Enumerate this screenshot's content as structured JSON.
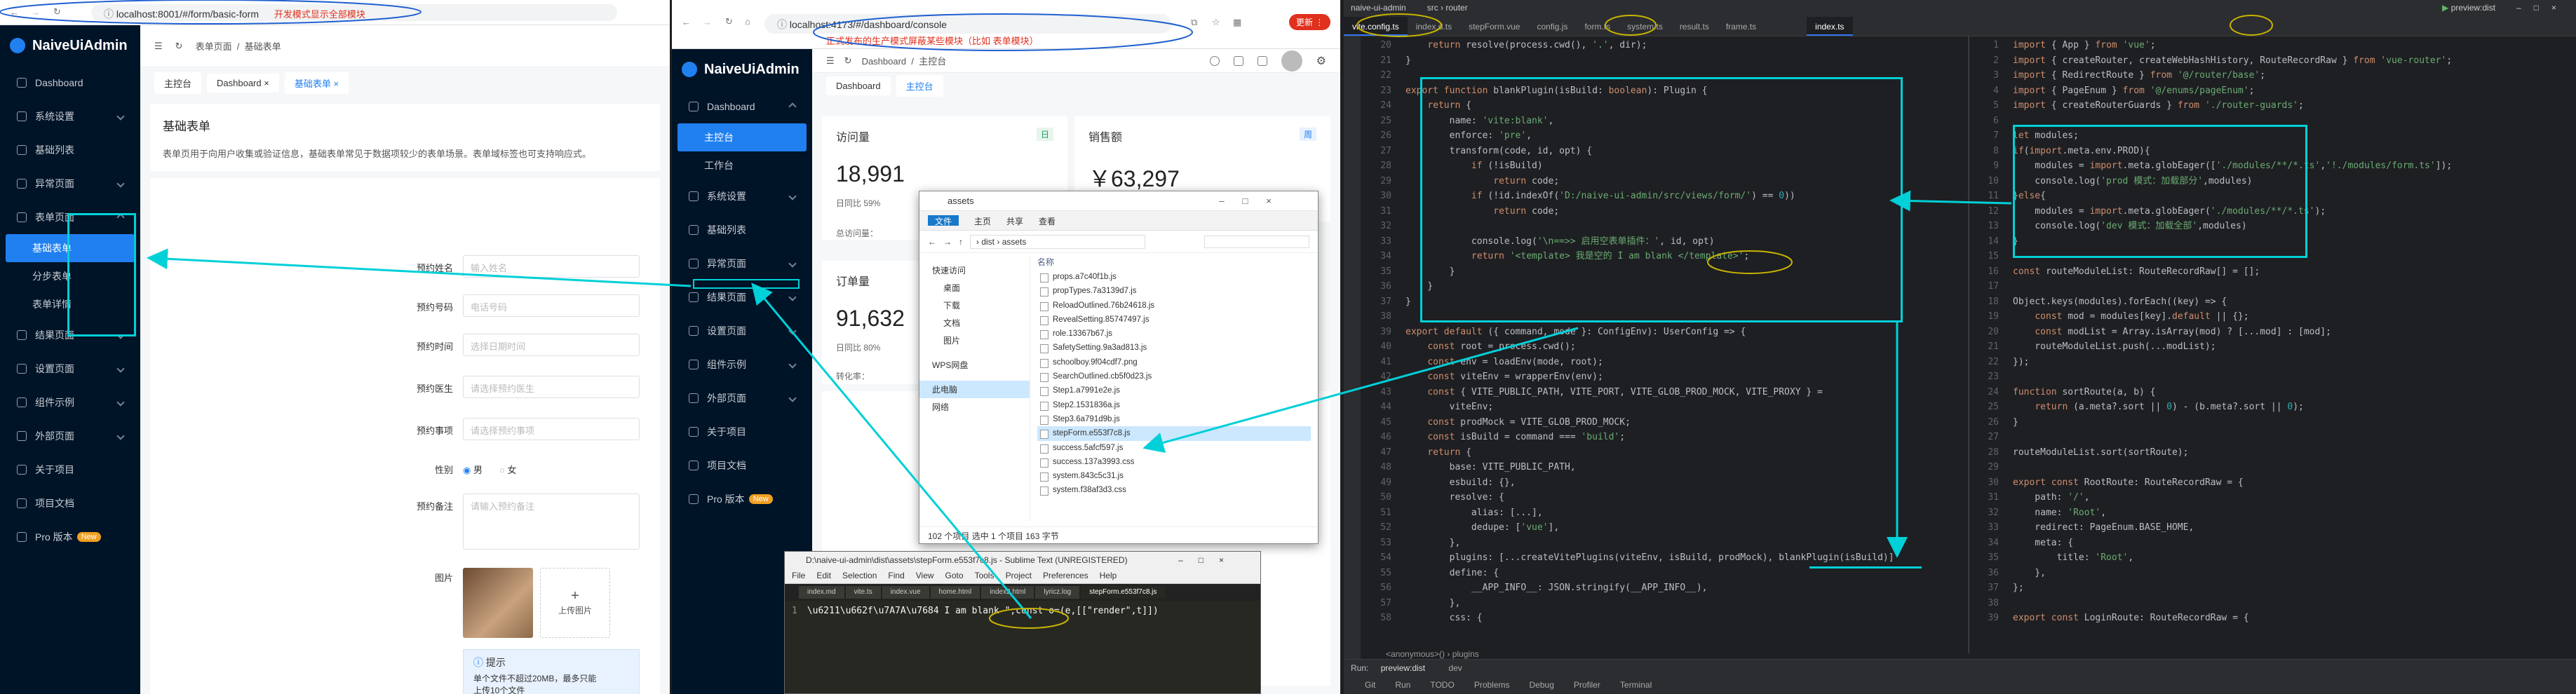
{
  "left_browser": {
    "url": "localhost:8001/#/form/basic-form",
    "url_note": "开发模式显示全部模块",
    "app_name": "NaiveUiAdmin",
    "sidebar": [
      "Dashboard",
      "系统设置",
      "基础列表",
      "异常页面",
      "表单页面",
      "基础表单",
      "分步表单",
      "表单详情",
      "结果页面",
      "设置页面",
      "组件示例",
      "外部页面",
      "关于项目",
      "项目文档",
      "Pro 版本"
    ],
    "pro_badge": "New",
    "breadcrumb": [
      "表单页面",
      "基础表单"
    ],
    "tabs": [
      "主控台",
      "Dashboard",
      "基础表单"
    ],
    "page_title": "基础表单",
    "page_desc": "表单页用于向用户收集或验证信息，基础表单常见于数据项较少的表单场景。表单域标签也可支持响应式。",
    "fields": [
      {
        "label": "预约姓名",
        "placeholder": "输入姓名"
      },
      {
        "label": "预约号码",
        "placeholder": "电话号码"
      },
      {
        "label": "预约时间",
        "placeholder": "选择日期时间"
      },
      {
        "label": "预约医生",
        "placeholder": "请选择预约医生"
      },
      {
        "label": "预约事项",
        "placeholder": "请选择预约事项"
      }
    ],
    "gender_label": "性别",
    "gender_opts": [
      "男",
      "女"
    ],
    "remark_label": "预约备注",
    "remark_placeholder": "请输入预约备注",
    "image_label": "图片",
    "upload_label": "上传图片",
    "tip_title": "提示",
    "tip_lines": [
      "单个文件不超过20MB，最多只能",
      "上传10个文件"
    ]
  },
  "mid_browser": {
    "url": "localhost:4173/#/dashboard/console",
    "url_note": "正式发布的生产模式屏蔽某些模块（比如 表单模块）",
    "app_name": "NaiveUiAdmin",
    "sidebar": [
      "Dashboard",
      "主控台",
      "工作台",
      "系统设置",
      "基础列表",
      "异常页面",
      "结果页面",
      "设置页面",
      "组件示例",
      "外部页面",
      "关于项目",
      "项目文档",
      "Pro 版本"
    ],
    "pro_badge": "New",
    "breadcrumb": [
      "Dashboard",
      "主控台"
    ],
    "tabs": [
      "Dashboard",
      "主控台"
    ],
    "cards": [
      {
        "title": "访问量",
        "tag": "日",
        "value": "18,991",
        "sub": "日同比 59%",
        "sub2": "总访问量："
      },
      {
        "title": "销售额",
        "tag": "周",
        "value": "￥63,297"
      },
      {
        "title": "订单量",
        "value": "91,632",
        "sub": "日同比 80%",
        "sub2": "转化率："
      }
    ]
  },
  "explorer": {
    "title": "assets",
    "ribbon": [
      "文件",
      "主页",
      "共享",
      "查看"
    ],
    "path": [
      "dist",
      "assets"
    ],
    "tree": [
      "快速访问",
      "桌面",
      "下载",
      "文档",
      "图片",
      "WPS网盘",
      "此电脑",
      "网络"
    ],
    "col_name": "名称",
    "files": [
      "props.a7c40f1b.js",
      "propTypes.7a3139d7.js",
      "ReloadOutlined.76b24618.js",
      "RevealSetting.85747497.js",
      "role.13367b67.js",
      "SafetySetting.9a3ad813.js",
      "schoolboy.9f04cdf7.png",
      "SearchOutlined.cb5f0d23.js",
      "Step1.a7991e2e.js",
      "Step2.1531836a.js",
      "Step3.6a791d9b.js",
      "stepForm.e553f7c8.js",
      "success.5afcf597.js",
      "success.137a3993.css",
      "system.843c5c31.js",
      "system.f38af3d3.css"
    ],
    "selected_file": "stepForm.e553f7c8.js",
    "status": "102 个项目    选中 1 个项目  163 字节"
  },
  "sublime": {
    "title": "D:\\naive-ui-admin\\dist\\assets\\stepForm.e553f7c8.js - Sublime Text (UNREGISTERED)",
    "menu": [
      "File",
      "Edit",
      "Selection",
      "Find",
      "View",
      "Goto",
      "Tools",
      "Project",
      "Preferences",
      "Help"
    ],
    "tabs": [
      "index.md",
      "vite.ts",
      "index.vue",
      "home.html",
      "index2.html",
      "lyricz.log",
      "stepForm.e553f7c8.js"
    ],
    "line_no": "1",
    "code": "\\u6211\\u662f\\u7A7A\\u7684 I am blank \";const o=(e,[[\"render\",t]])"
  },
  "ide": {
    "project": "naive-ui-admin",
    "crumbs": [
      "src",
      "router"
    ],
    "run_config": "preview:dist",
    "left_tabs": [
      "vite.config.ts",
      "index.d.ts",
      "stepForm.vue",
      "config.js",
      "form.ts",
      "system.ts",
      "result.ts",
      "frame.ts"
    ],
    "right_tab": "index.ts",
    "left_code": [
      "    return resolve(process.cwd(), '.', dir);",
      "}",
      "",
      "export function blankPlugin(isBuild: boolean): Plugin {",
      "    return {",
      "        name: 'vite:blank',",
      "        enforce: 'pre',",
      "        transform(code, id, opt) {",
      "            if (!isBuild)",
      "                return code;",
      "            if (!id.indexOf('D:/naive-ui-admin/src/views/form/') == 0))",
      "                return code;",
      "",
      "            console.log('\\n==>> 启用空表单插件：', id, opt)",
      "            return '<template> 我是空的 I am blank </template>';",
      "        }",
      "    }",
      "}",
      "",
      "export default ({ command, mode }: ConfigEnv): UserConfig => {",
      "    const root = process.cwd();",
      "    const env = loadEnv(mode, root);",
      "    const viteEnv = wrapperEnv(env);",
      "    const { VITE_PUBLIC_PATH, VITE_PORT, VITE_GLOB_PROD_MOCK, VITE_PROXY } =",
      "        viteEnv;",
      "    const prodMock = VITE_GLOB_PROD_MOCK;",
      "    const isBuild = command === 'build';",
      "    return {",
      "        base: VITE_PUBLIC_PATH,",
      "        esbuild: {},",
      "        resolve: {",
      "            alias: [...],",
      "            dedupe: ['vue'],",
      "        },",
      "        plugins: [...createVitePlugins(viteEnv, isBuild, prodMock), blankPlugin(isBuild)]",
      "        define: {",
      "            __APP_INFO__: JSON.stringify(__APP_INFO__),",
      "        },",
      "        css: {"
    ],
    "left_line_start": 20,
    "right_code": [
      "import { App } from 'vue';",
      "import { createRouter, createWebHashHistory, RouteRecordRaw } from 'vue-router';",
      "import { RedirectRoute } from '@/router/base';",
      "import { PageEnum } from '@/enums/pageEnum';",
      "import { createRouterGuards } from './router-guards';",
      "",
      "let modules;",
      "if(import.meta.env.PROD){",
      "    modules = import.meta.globEager(['./modules/**/*.ts','!./modules/form.ts']);",
      "    console.log('prod 模式：加载部分',modules)",
      "}else{",
      "    modules = import.meta.globEager('./modules/**/*.ts');",
      "    console.log('dev 模式：加载全部',modules)",
      "}",
      "",
      "const routeModuleList: RouteRecordRaw[] = [];",
      "",
      "Object.keys(modules).forEach((key) => {",
      "    const mod = modules[key].default || {};",
      "    const modList = Array.isArray(mod) ? [...mod] : [mod];",
      "    routeModuleList.push(...modList);",
      "});",
      "",
      "function sortRoute(a, b) {",
      "    return (a.meta?.sort || 0) - (b.meta?.sort || 0);",
      "}",
      "",
      "routeModuleList.sort(sortRoute);",
      "",
      "export const RootRoute: RouteRecordRaw = {",
      "    path: '/',",
      "    name: 'Root',",
      "    redirect: PageEnum.BASE_HOME,",
      "    meta: {",
      "        title: 'Root',",
      "    },",
      "};",
      "",
      "export const LoginRoute: RouteRecordRaw = {"
    ],
    "right_line_start": 1,
    "crumb_bottom": "<anonymous>() › plugins",
    "run_tab": "preview:dist",
    "dev_tab": "dev",
    "status_items": [
      "Git",
      "Run",
      "TODO",
      "Problems",
      "Debug",
      "Profiler",
      "Terminal"
    ]
  }
}
